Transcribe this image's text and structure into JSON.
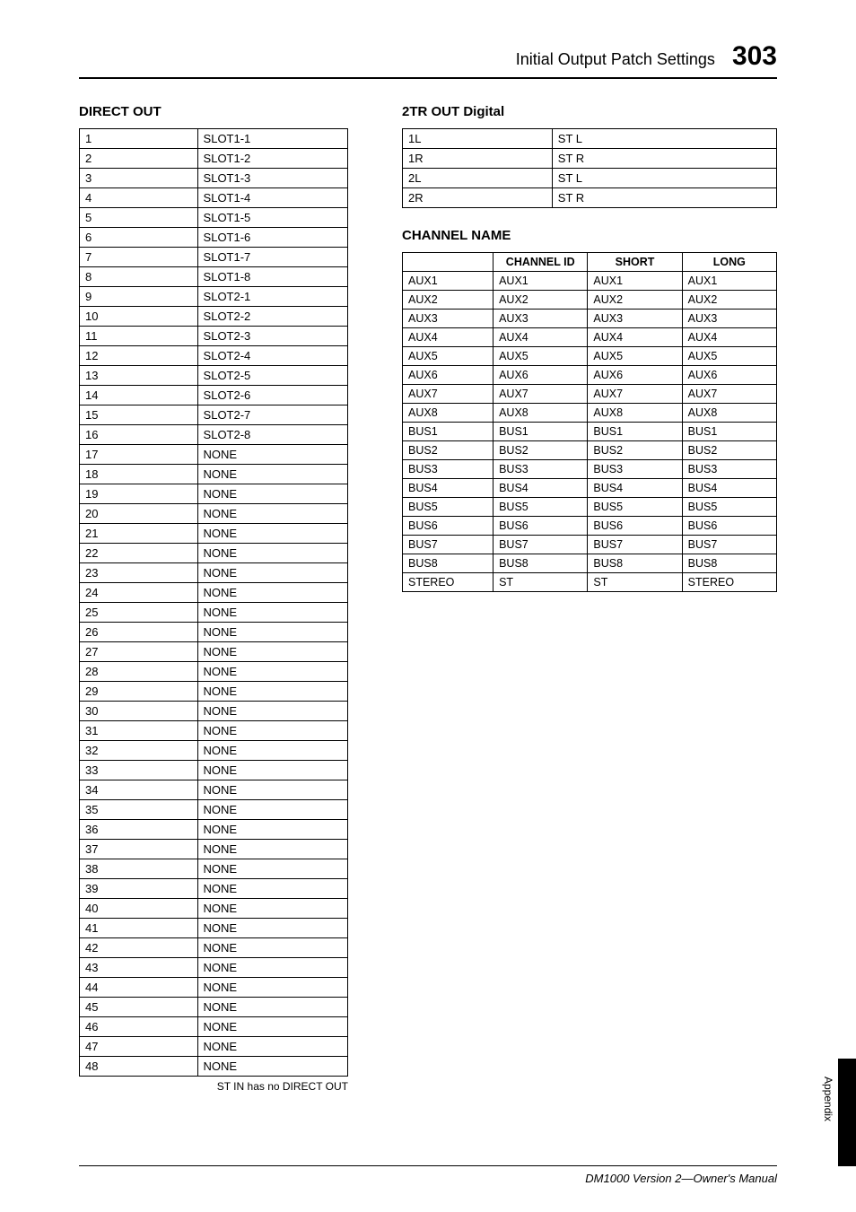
{
  "header": {
    "title": "Initial Output Patch Settings",
    "page_number": "303"
  },
  "direct_out": {
    "title": "DIRECT OUT",
    "rows": [
      [
        "1",
        "SLOT1-1"
      ],
      [
        "2",
        "SLOT1-2"
      ],
      [
        "3",
        "SLOT1-3"
      ],
      [
        "4",
        "SLOT1-4"
      ],
      [
        "5",
        "SLOT1-5"
      ],
      [
        "6",
        "SLOT1-6"
      ],
      [
        "7",
        "SLOT1-7"
      ],
      [
        "8",
        "SLOT1-8"
      ],
      [
        "9",
        "SLOT2-1"
      ],
      [
        "10",
        "SLOT2-2"
      ],
      [
        "11",
        "SLOT2-3"
      ],
      [
        "12",
        "SLOT2-4"
      ],
      [
        "13",
        "SLOT2-5"
      ],
      [
        "14",
        "SLOT2-6"
      ],
      [
        "15",
        "SLOT2-7"
      ],
      [
        "16",
        "SLOT2-8"
      ],
      [
        "17",
        "NONE"
      ],
      [
        "18",
        "NONE"
      ],
      [
        "19",
        "NONE"
      ],
      [
        "20",
        "NONE"
      ],
      [
        "21",
        "NONE"
      ],
      [
        "22",
        "NONE"
      ],
      [
        "23",
        "NONE"
      ],
      [
        "24",
        "NONE"
      ],
      [
        "25",
        "NONE"
      ],
      [
        "26",
        "NONE"
      ],
      [
        "27",
        "NONE"
      ],
      [
        "28",
        "NONE"
      ],
      [
        "29",
        "NONE"
      ],
      [
        "30",
        "NONE"
      ],
      [
        "31",
        "NONE"
      ],
      [
        "32",
        "NONE"
      ],
      [
        "33",
        "NONE"
      ],
      [
        "34",
        "NONE"
      ],
      [
        "35",
        "NONE"
      ],
      [
        "36",
        "NONE"
      ],
      [
        "37",
        "NONE"
      ],
      [
        "38",
        "NONE"
      ],
      [
        "39",
        "NONE"
      ],
      [
        "40",
        "NONE"
      ],
      [
        "41",
        "NONE"
      ],
      [
        "42",
        "NONE"
      ],
      [
        "43",
        "NONE"
      ],
      [
        "44",
        "NONE"
      ],
      [
        "45",
        "NONE"
      ],
      [
        "46",
        "NONE"
      ],
      [
        "47",
        "NONE"
      ],
      [
        "48",
        "NONE"
      ]
    ],
    "note": "ST IN has no DIRECT OUT"
  },
  "two_tr_out": {
    "title": "2TR OUT Digital",
    "rows": [
      [
        "1L",
        "ST L"
      ],
      [
        "1R",
        "ST R"
      ],
      [
        "2L",
        "ST L"
      ],
      [
        "2R",
        "ST R"
      ]
    ]
  },
  "channel_name": {
    "title": "CHANNEL NAME",
    "headers": [
      "",
      "CHANNEL ID",
      "SHORT",
      "LONG"
    ],
    "rows": [
      [
        "AUX1",
        "AUX1",
        "AUX1",
        "AUX1"
      ],
      [
        "AUX2",
        "AUX2",
        "AUX2",
        "AUX2"
      ],
      [
        "AUX3",
        "AUX3",
        "AUX3",
        "AUX3"
      ],
      [
        "AUX4",
        "AUX4",
        "AUX4",
        "AUX4"
      ],
      [
        "AUX5",
        "AUX5",
        "AUX5",
        "AUX5"
      ],
      [
        "AUX6",
        "AUX6",
        "AUX6",
        "AUX6"
      ],
      [
        "AUX7",
        "AUX7",
        "AUX7",
        "AUX7"
      ],
      [
        "AUX8",
        "AUX8",
        "AUX8",
        "AUX8"
      ],
      [
        "BUS1",
        "BUS1",
        "BUS1",
        "BUS1"
      ],
      [
        "BUS2",
        "BUS2",
        "BUS2",
        "BUS2"
      ],
      [
        "BUS3",
        "BUS3",
        "BUS3",
        "BUS3"
      ],
      [
        "BUS4",
        "BUS4",
        "BUS4",
        "BUS4"
      ],
      [
        "BUS5",
        "BUS5",
        "BUS5",
        "BUS5"
      ],
      [
        "BUS6",
        "BUS6",
        "BUS6",
        "BUS6"
      ],
      [
        "BUS7",
        "BUS7",
        "BUS7",
        "BUS7"
      ],
      [
        "BUS8",
        "BUS8",
        "BUS8",
        "BUS8"
      ],
      [
        "STEREO",
        "ST",
        "ST",
        "STEREO"
      ]
    ]
  },
  "sidebar": {
    "label": "Appendix"
  },
  "footer": {
    "text": "DM1000 Version 2—Owner's Manual"
  }
}
